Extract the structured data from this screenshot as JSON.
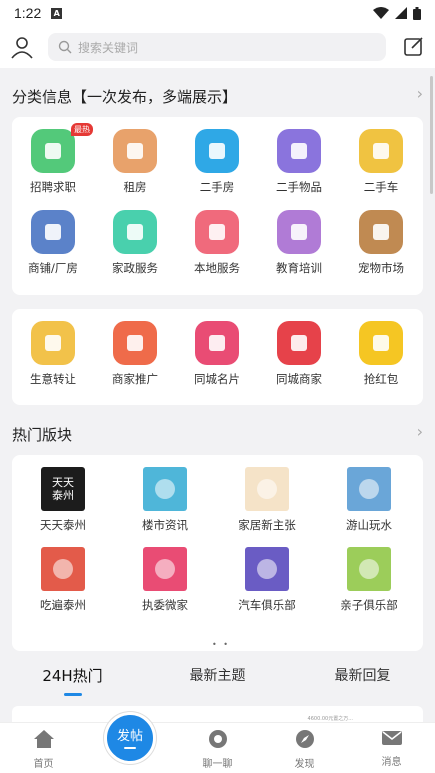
{
  "status": {
    "time": "1:22",
    "notif_icon": "A"
  },
  "header": {
    "search_placeholder": "搜索关键词",
    "user_icon": "user-icon",
    "edit_icon": "edit-icon"
  },
  "classify": {
    "title": "分类信息【一次发布，多端展示】",
    "items": [
      {
        "label": "招聘求职",
        "badge": "最热",
        "color": "#53c97a"
      },
      {
        "label": "租房",
        "color": "#e8a26b"
      },
      {
        "label": "二手房",
        "color": "#2fa8e6"
      },
      {
        "label": "二手物品",
        "color": "#8a74dd"
      },
      {
        "label": "二手车",
        "color": "#f0c341"
      },
      {
        "label": "商铺/厂房",
        "color": "#5b82c9"
      },
      {
        "label": "家政服务",
        "color": "#49d0ad"
      },
      {
        "label": "本地服务",
        "color": "#f06a7c"
      },
      {
        "label": "教育培训",
        "color": "#b07bd6"
      },
      {
        "label": "宠物市场",
        "color": "#c08a52"
      }
    ]
  },
  "services": {
    "items": [
      {
        "label": "生意转让",
        "color": "#f2c24a"
      },
      {
        "label": "商家推广",
        "color": "#ef6b4a"
      },
      {
        "label": "同城名片",
        "color": "#e94c74"
      },
      {
        "label": "同城商家",
        "color": "#e6424a"
      },
      {
        "label": "抢红包",
        "color": "#f5c623"
      }
    ]
  },
  "hot": {
    "title": "热门版块",
    "items": [
      {
        "label": "天天泰州",
        "thumb_text": "天天泰州",
        "color": "#1c1c1c"
      },
      {
        "label": "楼市资讯",
        "color": "#4fb6d9"
      },
      {
        "label": "家居新主张",
        "color": "#f5e3c8"
      },
      {
        "label": "游山玩水",
        "color": "#6aa6d8"
      },
      {
        "label": "吃遍泰州",
        "color": "#e35b4a"
      },
      {
        "label": "执委微家",
        "color": "#e94c74"
      },
      {
        "label": "汽车俱乐部",
        "color": "#6a5cc4"
      },
      {
        "label": "亲子俱乐部",
        "color": "#9ccd5a"
      }
    ]
  },
  "pager": "• •",
  "tabs": [
    {
      "label": "24H热门",
      "active": true
    },
    {
      "label": "最新主题"
    },
    {
      "label": "最新回复"
    }
  ],
  "preview_text": "4600.00元置之万...",
  "bottom_nav": {
    "home": "首页",
    "post": "发帖",
    "chat": "聊一聊",
    "discover": "发现",
    "message": "消息"
  }
}
